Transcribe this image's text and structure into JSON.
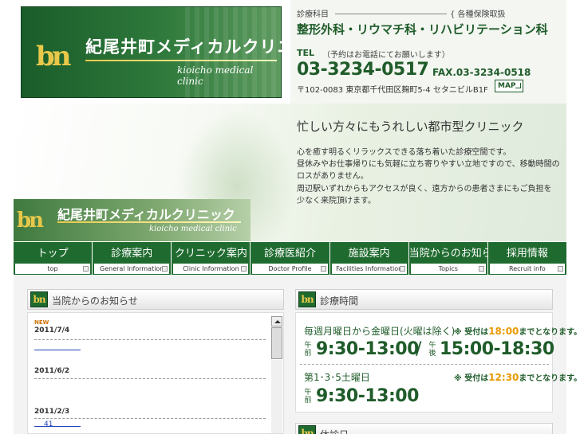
{
  "header": {
    "logo_mark": "bn",
    "clinic_name": "紀尾井町メディカルクリニック",
    "clinic_name_en": "kioicho medical clinic"
  },
  "info": {
    "dept_label": "診療科目",
    "insurance": "{ 各種保険取扱",
    "departments": "整形外科・リウマチ科・リハビリテーション科",
    "tel_label": "TEL",
    "tel_note": "（予約はお電話にてお願いします）",
    "tel": "03-3234-0517",
    "fax": "FAX.03-3234-0518",
    "address": "〒102-0083 東京都千代田区麹町5-4 セタニビルB1F",
    "map_label": "MAP"
  },
  "hero": {
    "headline": "忙しい方々にもうれしい都市型クリニック",
    "lines": [
      "心を癒す明るくリラックスできる落ち着いた診療空間です。",
      "昼休みやお仕事帰りにも気軽に立ち寄りやすい立地ですので、移動時間の",
      "ロスがありません。",
      "周辺駅いずれからもアクセスが良く、遠方からの患者さまにもご負担を",
      "少なく来院頂けます。"
    ],
    "logo_mark": "bn",
    "clinic_name": "紀尾井町メディカルクリニック",
    "clinic_name_en": "kioicho medical clinic"
  },
  "nav": [
    {
      "ja": "トップ",
      "en": "top"
    },
    {
      "ja": "診療案内",
      "en": "General Information"
    },
    {
      "ja": "クリニック案内",
      "en": "Clinic Information"
    },
    {
      "ja": "診療医紹介",
      "en": "Doctor Profile"
    },
    {
      "ja": "施設案内",
      "en": "Facilities Information"
    },
    {
      "ja": "当院からのお知らせ",
      "en": "Topics"
    },
    {
      "ja": "採用情報",
      "en": "Recruit info"
    }
  ],
  "news": {
    "icon": "bn",
    "title": "当院からのお知らせ",
    "items": [
      {
        "badge": "NEW",
        "date": "2011/7/4",
        "link": ""
      },
      {
        "badge": "",
        "date": "2011/6/2",
        "link": ""
      },
      {
        "badge": "",
        "date": "2011/2/3",
        "link": "41"
      }
    ]
  },
  "hours": {
    "icon": "bn",
    "title": "診療時間",
    "weekday_label": "毎週月曜日から金曜日(火曜は除く)",
    "weekday_note_pre": "※ 受付は",
    "weekday_note_time": "18:00",
    "weekday_note_post": "までとなります。",
    "am": "午前",
    "pm": "午後",
    "weekday_am": "9:30-13:00",
    "slash": "/",
    "weekday_pm": "15:00-18:30",
    "saturday_label": "第1･3･5土曜日",
    "saturday_note_pre": "※ 受付は",
    "saturday_note_time": "12:30",
    "saturday_note_post": "までとなります。",
    "saturday_am": "9:30-13:00"
  },
  "holiday": {
    "icon": "bn",
    "title": "休診日"
  },
  "colors": {
    "brand_green": "#1f6b2f",
    "accent_gold": "#e8c84a",
    "note_orange": "#e89a00",
    "link_blue": "#2244bb"
  }
}
